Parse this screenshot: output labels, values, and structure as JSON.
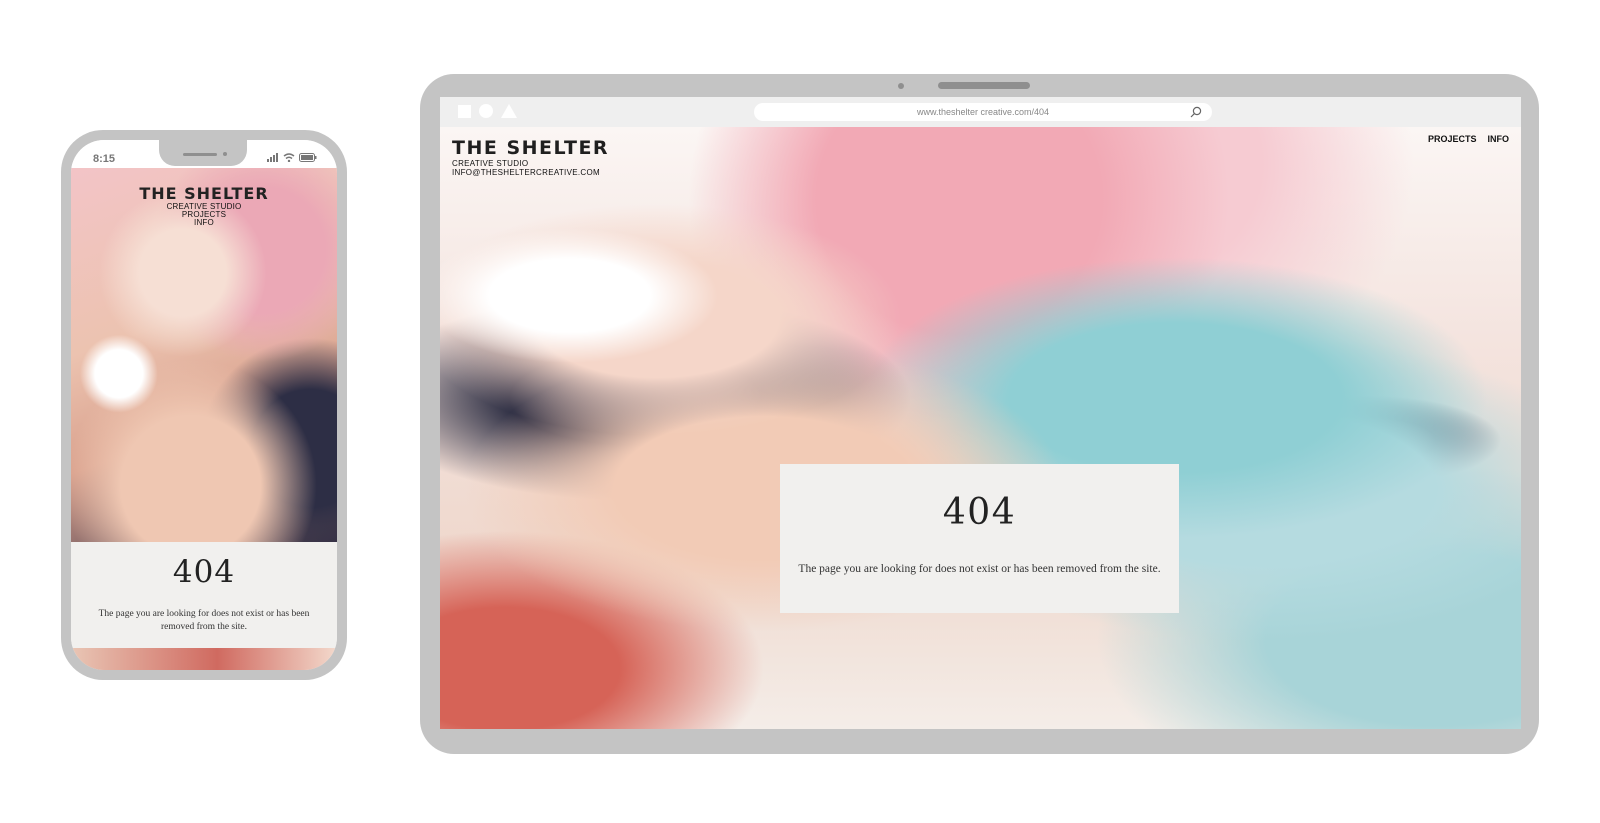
{
  "phone": {
    "time": "8:15",
    "brand": {
      "logo": "THE SHELTER",
      "tagline": "CREATIVE STUDIO",
      "nav_projects": "PROJECTS",
      "nav_info": "INFO"
    },
    "error": {
      "code": "404",
      "message": "The page you are looking for does not exist or has been removed from the site."
    }
  },
  "laptop": {
    "url": "www.theshelter creative.com/404",
    "brand": {
      "logo": "THE SHELTER",
      "tagline": "CREATIVE STUDIO",
      "email": "INFO@THESHELTERCREATIVE.COM"
    },
    "nav": {
      "projects": "PROJECTS",
      "info": "INFO"
    },
    "error": {
      "code": "404",
      "message": "The page you are looking for does not exist or has been removed from the site."
    }
  },
  "colors": {
    "device_frame": "#c4c4c4",
    "card_bg": "#f1f0ee",
    "text_dark": "#222222"
  }
}
